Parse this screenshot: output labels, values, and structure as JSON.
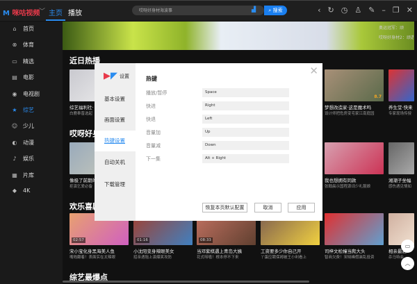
{
  "header": {
    "logo": "咪咕视频",
    "tabs": [
      "主页",
      "播放"
    ],
    "search_placeholder": "哎呀好身材海波事",
    "search_button": "搜索"
  },
  "sidebar": {
    "items": [
      {
        "icon": "home-icon",
        "glyph": "⌂",
        "label": "首页"
      },
      {
        "icon": "sports-icon",
        "glyph": "⊗",
        "label": "体育"
      },
      {
        "icon": "camera-icon",
        "glyph": "▭",
        "label": "精选"
      },
      {
        "icon": "film-icon",
        "glyph": "▤",
        "label": "电影"
      },
      {
        "icon": "tv-icon",
        "glyph": "◉",
        "label": "电视剧"
      },
      {
        "icon": "star-icon",
        "glyph": "★",
        "label": "综艺"
      },
      {
        "icon": "kids-icon",
        "glyph": "☺",
        "label": "少儿"
      },
      {
        "icon": "anime-icon",
        "glyph": "◐",
        "label": "动漫"
      },
      {
        "icon": "music-icon",
        "glyph": "♪",
        "label": "娱乐"
      },
      {
        "icon": "library-icon",
        "glyph": "▦",
        "label": "片库"
      },
      {
        "icon": "4k-icon",
        "glyph": "◆",
        "label": "4K"
      }
    ],
    "active": "综艺"
  },
  "banner": {
    "lines": [
      "奥运冠军：顽",
      "哎呀好身材2：顽透"
    ]
  },
  "sections": [
    {
      "title": "近日热播",
      "cards": [
        {
          "t1": "综艺福利社·",
          "t2": "白鹿奉晋选起"
        },
        {
          "t1": "",
          "t2": ""
        },
        {
          "t1": "",
          "t2": ""
        },
        {
          "t1": "",
          "t2": ""
        },
        {
          "t1": "梦想改造家·这是魔术吗",
          "t2": "设计师把危房变宅家江南庭园",
          "rate": "8.7"
        },
        {
          "t1": "养生堂·快来",
          "t2": "专家现场传授"
        }
      ]
    },
    {
      "title": "哎呀好身材",
      "cards": [
        {
          "t1": "像极了前期的",
          "t2": "拒演乞爱必备"
        },
        {
          "t1": "",
          "t2": ""
        },
        {
          "t1": "",
          "t2": ""
        },
        {
          "t1": "",
          "t2": ""
        },
        {
          "t1": "我也想拥有同款",
          "t2": "张翰晨示国程源词少礼服娘"
        },
        {
          "t1": "湘潮子坐幅",
          "t2": "感伤遇见情如"
        }
      ]
    },
    {
      "title": "欢乐喜剧人",
      "cards": [
        {
          "t1": "宋小宝化身黑海美人鱼",
          "t2": "嘴贱翻着！表面实在太辣眼",
          "dur": "02:57"
        },
        {
          "t1": "小沈阳变身辣眼美女",
          "t2": "招亲遇阻上演爆笑攻防",
          "dur": "01:16"
        },
        {
          "t1": "当邓紫棋遇上青岛大姨",
          "t2": "花式唠嗑！根本停不下来",
          "dur": "08:33"
        },
        {
          "t1": "工资要多少你自己开",
          "t2": "丫蛋应聘保姆被王小利看上"
        },
        {
          "t1": "司梓文松幢当爬大头",
          "t2": "智商欠费！宋晓峰假装乱投资"
        },
        {
          "t1": "相亲最高",
          "t2": "杀马特会"
        }
      ]
    }
  ],
  "section4_title": "综艺最爆点",
  "dialog": {
    "logo_label": "设置",
    "nav": [
      "基本设置",
      "画面设置",
      "热键设置",
      "自动关机",
      "下载管理"
    ],
    "active": "热键设置",
    "heading": "热键",
    "hotkeys": [
      {
        "label": "播放/暂停",
        "value": "Space"
      },
      {
        "label": "快进",
        "value": "Right"
      },
      {
        "label": "快退",
        "value": "Left"
      },
      {
        "label": "音量加",
        "value": "Up"
      },
      {
        "label": "音量减",
        "value": "Down"
      },
      {
        "label": "下一集",
        "value": "Alt + Right"
      }
    ],
    "buttons": {
      "reset": "恢复本页默认配置",
      "cancel": "取消",
      "apply": "应用"
    }
  },
  "colors": {
    "accent": "#2a8cf0",
    "brand_red": "#e83a4a"
  }
}
